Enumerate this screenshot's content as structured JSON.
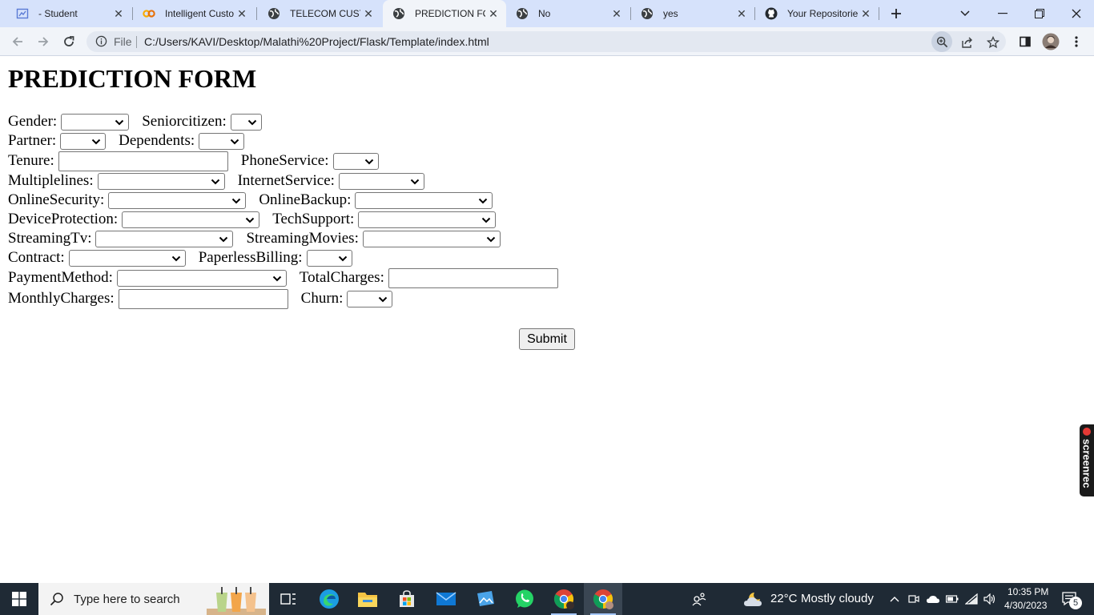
{
  "browser": {
    "tabs": [
      {
        "title": "- Student",
        "icon": "student-app-icon",
        "active": false
      },
      {
        "title": "Intelligent Customer",
        "icon": "colab-icon",
        "active": false
      },
      {
        "title": "TELECOM CUSTOMER",
        "icon": "globe-icon",
        "active": false
      },
      {
        "title": "PREDICTION FORM",
        "icon": "globe-icon",
        "active": true
      },
      {
        "title": "No",
        "icon": "globe-icon",
        "active": false
      },
      {
        "title": "yes",
        "icon": "globe-icon",
        "active": false
      },
      {
        "title": "Your Repositories",
        "icon": "github-icon",
        "active": false
      }
    ],
    "address": {
      "scheme_label": "File",
      "url": "C:/Users/KAVI/Desktop/Malathi%20Project/Flask/Template/index.html"
    }
  },
  "form": {
    "heading": "PREDICTION FORM",
    "labels": {
      "gender": "Gender:",
      "seniorcitizen": "Seniorcitizen:",
      "partner": "Partner:",
      "dependents": "Dependents:",
      "tenure": "Tenure:",
      "phoneservice": "PhoneService:",
      "multiplelines": "Multiplelines:",
      "internetservice": "InternetService:",
      "onlinesecurity": "OnlineSecurity:",
      "onlinebackup": "OnlineBackup:",
      "deviceprotection": "DeviceProtection:",
      "techsupport": "TechSupport:",
      "streamingtv": "StreamingTv:",
      "streamingmovies": "StreamingMovies:",
      "contract": "Contract:",
      "paperlessbilling": "PaperlessBilling:",
      "paymentmethod": "PaymentMethod:",
      "totalcharges": "TotalCharges:",
      "monthlycharges": "MonthlyCharges:",
      "churn": "Churn:"
    },
    "values": {
      "gender": "",
      "seniorcitizen": "",
      "partner": "",
      "dependents": "",
      "tenure": "",
      "phoneservice": "",
      "multiplelines": "",
      "internetservice": "",
      "onlinesecurity": "",
      "onlinebackup": "",
      "deviceprotection": "",
      "techsupport": "",
      "streamingtv": "",
      "streamingmovies": "",
      "contract": "",
      "paperlessbilling": "",
      "paymentmethod": "",
      "totalcharges": "",
      "monthlycharges": "",
      "churn": ""
    },
    "submit_label": "Submit"
  },
  "screenrec": {
    "label": "screenrec"
  },
  "taskbar": {
    "search_placeholder": "Type here to search",
    "weather": {
      "temp": "22°C",
      "condition": "Mostly cloudy"
    },
    "clock": {
      "time": "10:35 PM",
      "date": "4/30/2023"
    },
    "notification_count": "5"
  }
}
